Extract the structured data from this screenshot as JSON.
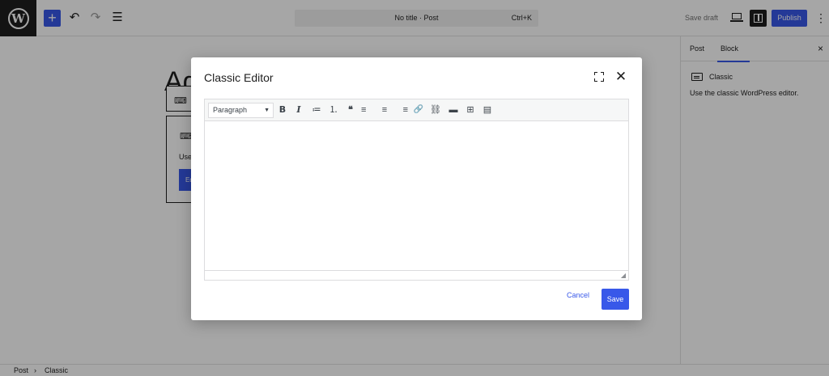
{
  "topbar": {
    "logo_letter": "W",
    "add_symbol": "+",
    "undo_symbol": "↶",
    "redo_symbol": "↷",
    "list_view_symbol": "☰",
    "command_bar": {
      "title": "No title · Post",
      "shortcut": "Ctrl+K"
    },
    "save_draft_label": "Save draft",
    "publish_label": "Publish",
    "more_symbol": "⋮"
  },
  "canvas": {
    "heading_partial": "Ad",
    "block_text_partial": "Use",
    "block_button_partial": "Ed",
    "keyboard_symbol": "⌨"
  },
  "sidebar": {
    "tabs": [
      {
        "label": "Post"
      },
      {
        "label": "Block"
      }
    ],
    "active_tab": "Block",
    "close_symbol": "×",
    "block_name": "Classic",
    "block_description": "Use the classic WordPress editor."
  },
  "modal": {
    "title": "Classic Editor",
    "close_symbol": "✕",
    "format_select": {
      "value": "Paragraph",
      "caret": "▼"
    },
    "toolbar": {
      "bold": "B",
      "italic": "I",
      "bullet_list": "≔",
      "numbered_list": "⒈",
      "blockquote": "❝",
      "align_left": "≡",
      "align_center": "≡",
      "align_right": "≡",
      "link": "🔗",
      "unlink": "⛓",
      "read_more": "▬",
      "toolbar_toggle": "⊞",
      "kitchen_sink": "▤"
    },
    "resize_symbol": "◢",
    "cancel_label": "Cancel",
    "save_label": "Save"
  },
  "footer": {
    "breadcrumbs": [
      "Post",
      "Classic"
    ],
    "separator": "›"
  },
  "colors": {
    "accent": "#3858e9",
    "overlay": "rgba(0,0,0,0.35)",
    "dark": "#1e1e1e"
  }
}
